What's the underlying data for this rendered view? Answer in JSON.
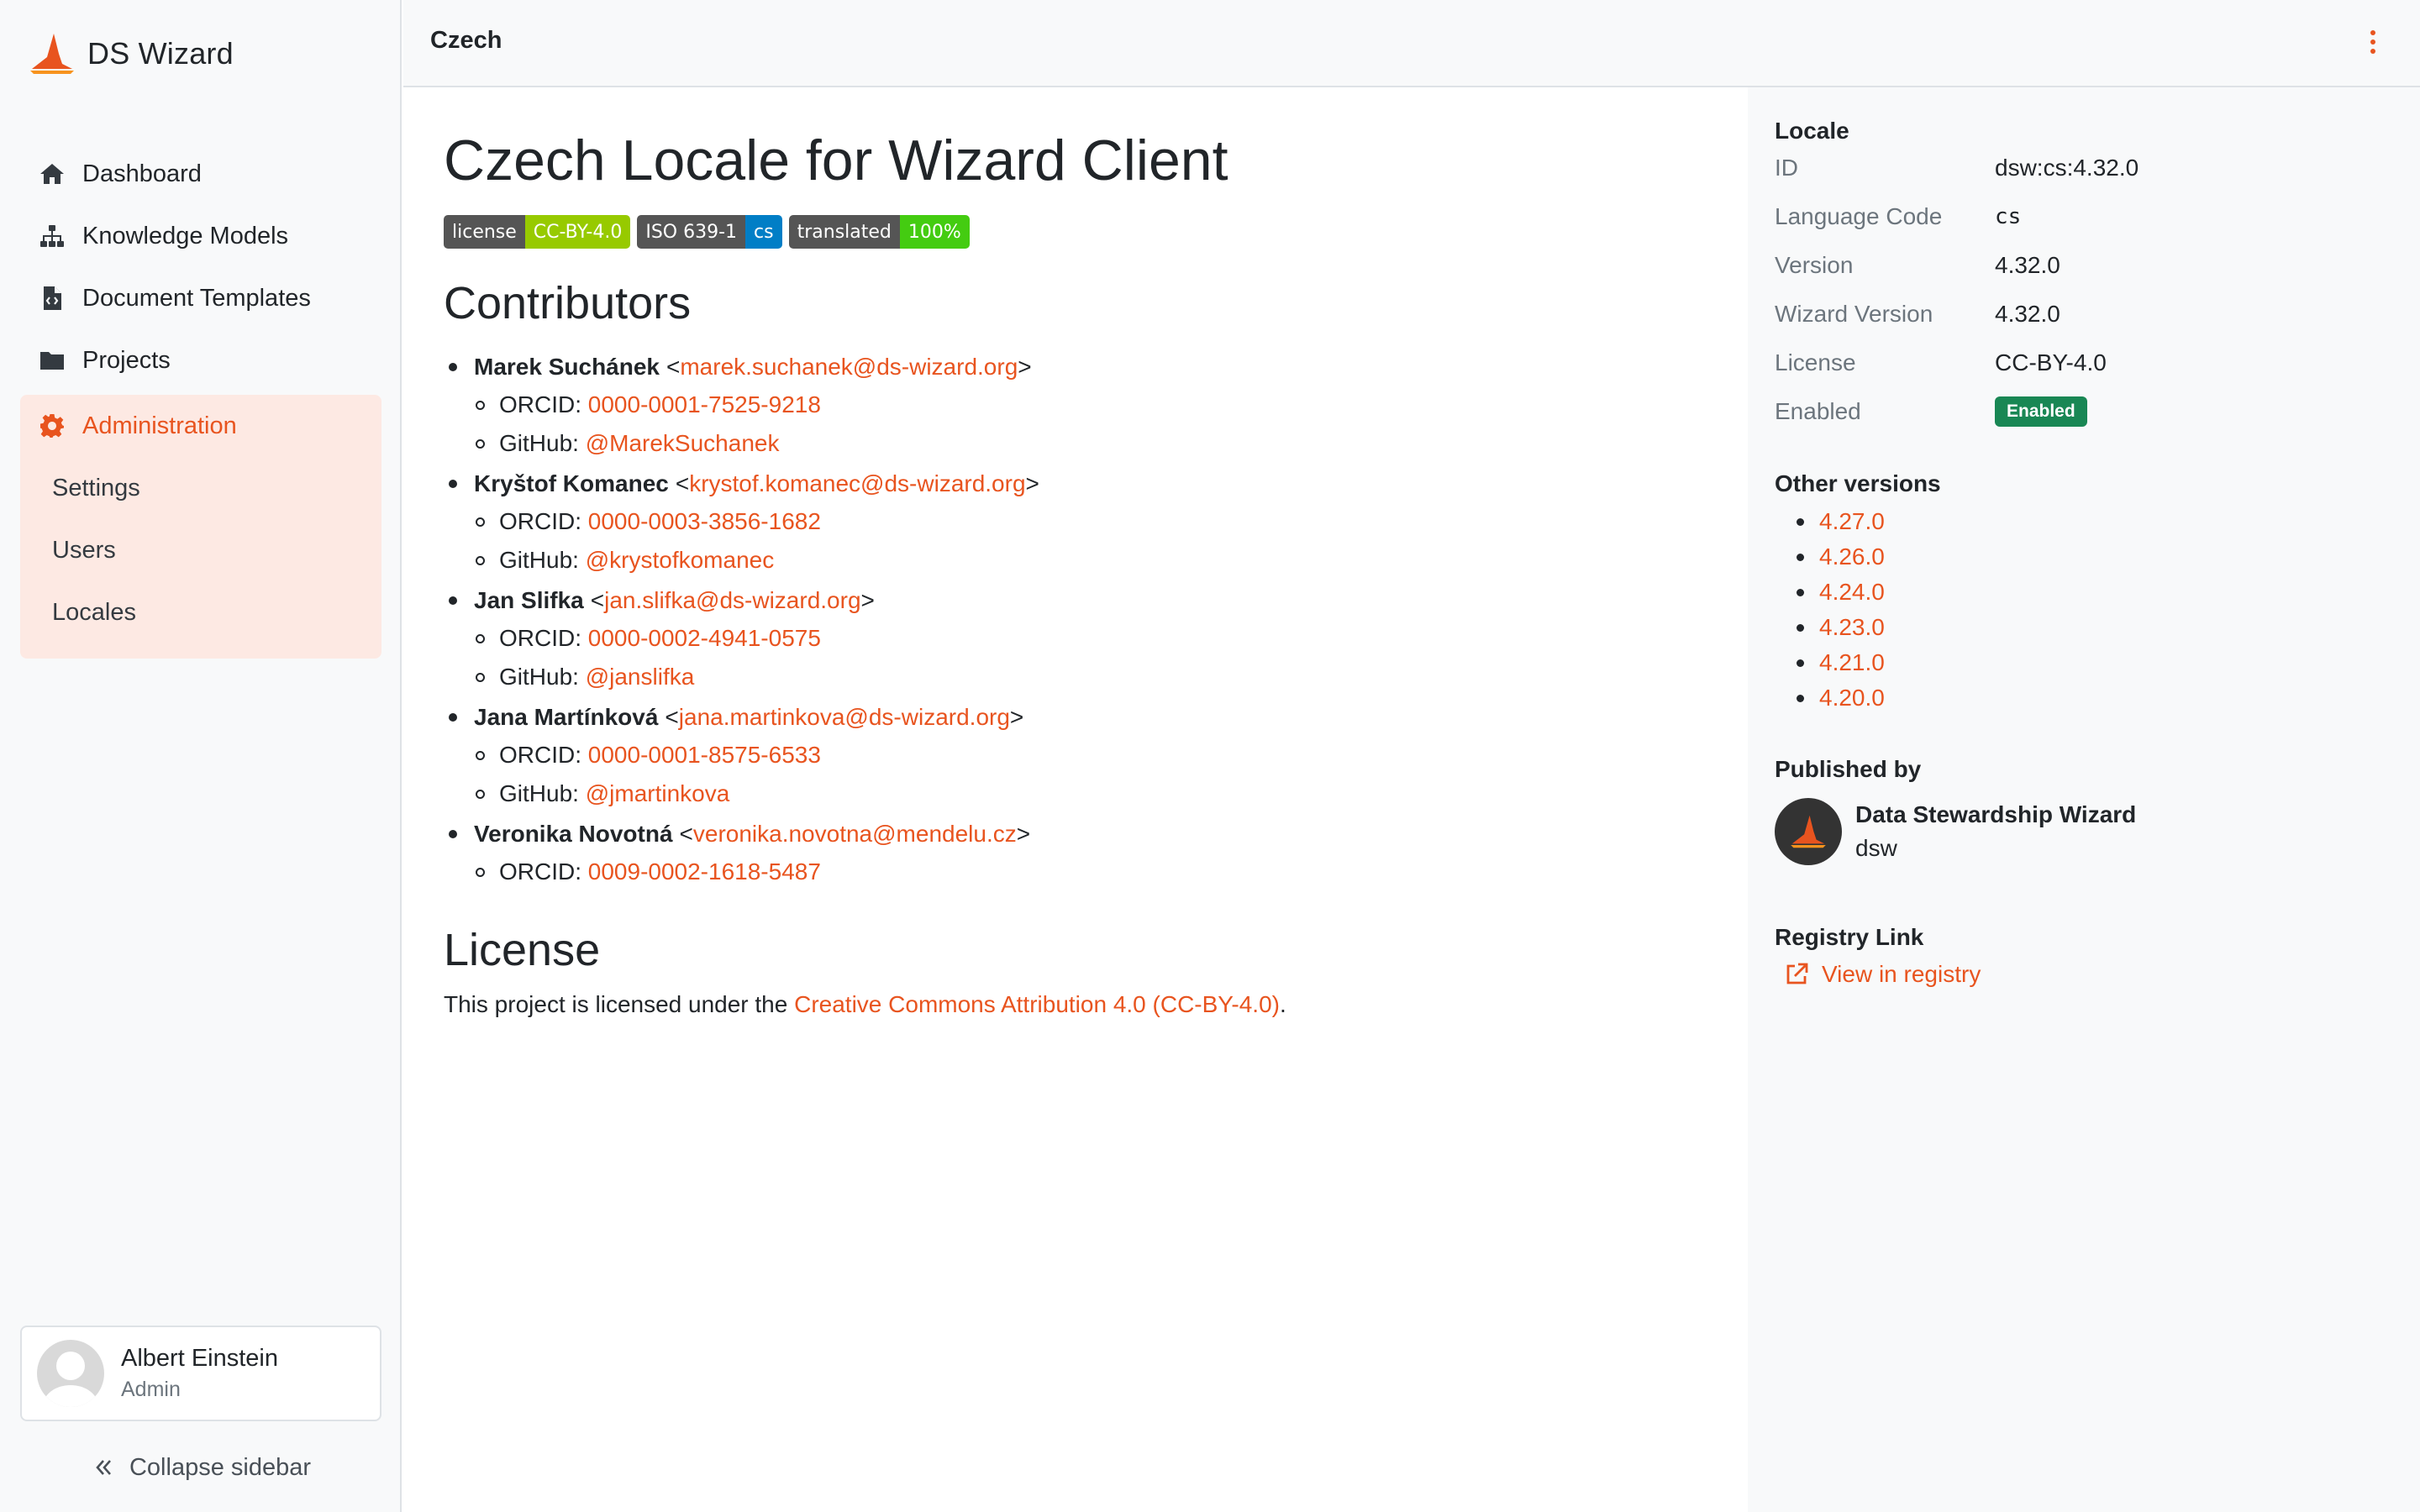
{
  "app": {
    "name": "DS Wizard",
    "accent": "#e8541f"
  },
  "sidebar": {
    "items": [
      {
        "label": "Dashboard",
        "icon": "home-icon"
      },
      {
        "label": "Knowledge Models",
        "icon": "sitemap-icon"
      },
      {
        "label": "Document Templates",
        "icon": "file-code-icon"
      },
      {
        "label": "Projects",
        "icon": "folder-icon"
      },
      {
        "label": "Administration",
        "icon": "gear-icon"
      }
    ],
    "admin_sub": [
      "Settings",
      "Users",
      "Locales"
    ],
    "profile": {
      "name": "Albert Einstein",
      "role": "Admin"
    },
    "collapse_label": "Collapse sidebar"
  },
  "topbar": {
    "title": "Czech"
  },
  "main": {
    "title": "Czech Locale for Wizard Client",
    "badges": [
      {
        "key": "license",
        "value": "CC-BY-4.0",
        "color": "#97ca00"
      },
      {
        "key": "ISO 639-1",
        "value": "cs",
        "color": "#007ec6"
      },
      {
        "key": "translated",
        "value": "100%",
        "color": "#44cc11"
      }
    ],
    "contributors_heading": "Contributors",
    "contributors": [
      {
        "name": "Marek Suchánek",
        "email": "marek.suchanek@ds-wizard.org",
        "orcid": "0000-0001-7525-9218",
        "github": "@MarekSuchanek"
      },
      {
        "name": "Kryštof Komanec",
        "email": "krystof.komanec@ds-wizard.org",
        "orcid": "0000-0003-3856-1682",
        "github": "@krystofkomanec"
      },
      {
        "name": "Jan Slifka",
        "email": "jan.slifka@ds-wizard.org",
        "orcid": "0000-0002-4941-0575",
        "github": "@janslifka"
      },
      {
        "name": "Jana Martínková",
        "email": "jana.martinkova@ds-wizard.org",
        "orcid": "0000-0001-8575-6533",
        "github": "@jmartinkova"
      },
      {
        "name": "Veronika Novotná",
        "email": "veronika.novotna@mendelu.cz",
        "orcid": "0009-0002-1618-5487",
        "github": ""
      }
    ],
    "orcid_label": "ORCID:",
    "github_label": "GitHub:",
    "license_heading": "License",
    "license_text_before": "This project is licensed under the ",
    "license_link": "Creative Commons Attribution 4.0 (CC-BY-4.0)",
    "license_text_after": "."
  },
  "panel": {
    "locale_heading": "Locale",
    "fields": {
      "id": {
        "label": "ID",
        "value": "dsw:cs:4.32.0"
      },
      "language_code": {
        "label": "Language Code",
        "value": "cs"
      },
      "version": {
        "label": "Version",
        "value": "4.32.0"
      },
      "wizard_version": {
        "label": "Wizard Version",
        "value": "4.32.0"
      },
      "license": {
        "label": "License",
        "value": "CC-BY-4.0"
      },
      "enabled": {
        "label": "Enabled",
        "value": "Enabled"
      }
    },
    "other_versions_heading": "Other versions",
    "other_versions": [
      "4.27.0",
      "4.26.0",
      "4.24.0",
      "4.23.0",
      "4.21.0",
      "4.20.0"
    ],
    "published_by_heading": "Published by",
    "publisher": {
      "name": "Data Stewardship Wizard",
      "id": "dsw"
    },
    "registry_heading": "Registry Link",
    "registry_link": "View in registry"
  }
}
